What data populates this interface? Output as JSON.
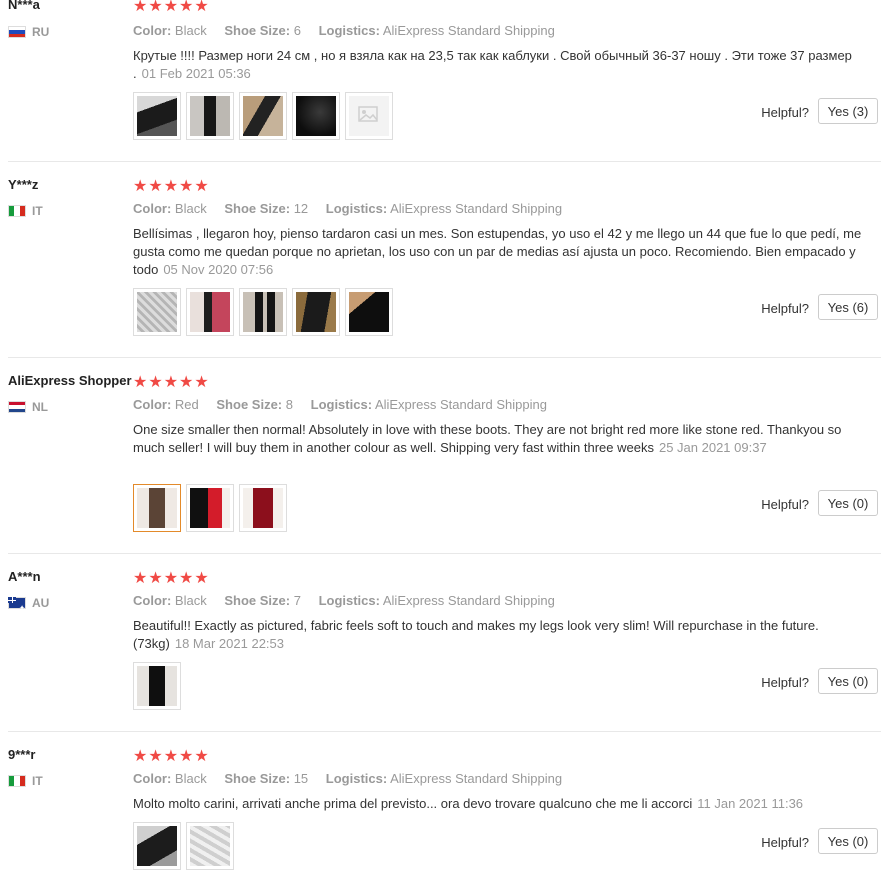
{
  "labels": {
    "color": "Color:",
    "shoe_size": "Shoe Size:",
    "logistics": "Logistics:",
    "helpful": "Helpful?"
  },
  "star_color": "#f04a45",
  "reviews": [
    {
      "name": "N***a",
      "country": "RU",
      "flag": "russia-flag-icon",
      "stars": "★★★★★",
      "color": "Black",
      "shoe_size": "6",
      "logistics": "AliExpress Standard Shipping",
      "text": "Крутые !!!! Размер ноги 24 см , но я взяла как на 23,5 так как каблуки . Свой обычный 36-37 ношу . Эти тоже 37 размер .",
      "date": "01 Feb 2021 05:36",
      "yes": "Yes (3)"
    },
    {
      "name": "Y***z",
      "country": "IT",
      "flag": "italy-flag-icon",
      "stars": "★★★★★",
      "color": "Black",
      "shoe_size": "12",
      "logistics": "AliExpress Standard Shipping",
      "text": "Bellísimas , llegaron hoy, pienso tardaron casi un mes. Son estupendas, yo uso el 42 y me llego un 44 que fue lo que pedí, me gusta como me quedan porque no aprietan, los uso con un par de medias así ajusta un poco. Recomiendo. Bien empacado y todo",
      "date": "05 Nov 2020 07:56",
      "yes": "Yes (6)"
    },
    {
      "name": "AliExpress Shopper",
      "country": "NL",
      "flag": "netherlands-flag-icon",
      "stars": "★★★★★",
      "color": "Red",
      "shoe_size": "8",
      "logistics": "AliExpress Standard Shipping",
      "text": "One size smaller then normal! Absolutely in love with these boots. They are not bright red more like stone red. Thankyou so much seller! I will buy them in another colour as well. Shipping very fast within three weeks",
      "date": "25 Jan 2021 09:37",
      "yes": "Yes (0)"
    },
    {
      "name": "A***n",
      "country": "AU",
      "flag": "australia-flag-icon",
      "stars": "★★★★★",
      "color": "Black",
      "shoe_size": "7",
      "logistics": "AliExpress Standard Shipping",
      "text": "Beautiful!! Exactly as pictured, fabric feels soft to touch and makes my legs look very slim! Will repurchase in the future. (73kg)",
      "date": "18 Mar 2021 22:53",
      "yes": "Yes (0)"
    },
    {
      "name": "9***r",
      "country": "IT",
      "flag": "italy-flag-icon",
      "stars": "★★★★★",
      "color": "Black",
      "shoe_size": "15",
      "logistics": "AliExpress Standard Shipping",
      "text": "Molto molto carini, arrivati anche prima del previsto... ora devo trovare qualcuno che me li accorci",
      "date": "11 Jan 2021 11:36",
      "yes": "Yes (0)"
    }
  ]
}
